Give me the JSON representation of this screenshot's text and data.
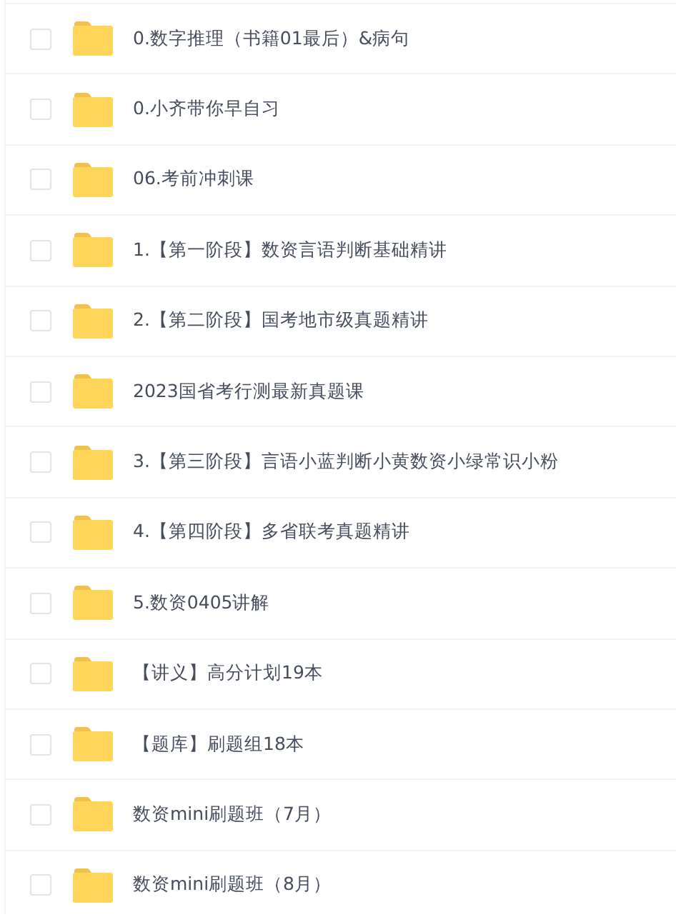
{
  "files": [
    {
      "name": "0.数字推理（书籍01最后）&病句",
      "checked": false
    },
    {
      "name": "0.小齐带你早自习",
      "checked": false
    },
    {
      "name": "06.考前冲刺课",
      "checked": false
    },
    {
      "name": "1.【第一阶段】数资言语判断基础精讲",
      "checked": false
    },
    {
      "name": "2.【第二阶段】国考地市级真题精讲",
      "checked": false
    },
    {
      "name": "2023国省考行测最新真题课",
      "checked": false
    },
    {
      "name": "3.【第三阶段】言语小蓝判断小黄数资小绿常识小粉",
      "checked": false
    },
    {
      "name": "4.【第四阶段】多省联考真题精讲",
      "checked": false
    },
    {
      "name": "5.数资0405讲解",
      "checked": false
    },
    {
      "name": "【讲义】高分计划19本",
      "checked": false
    },
    {
      "name": "【题库】刷题组18本",
      "checked": false
    },
    {
      "name": "数资mini刷题班（7月）",
      "checked": false
    },
    {
      "name": "数资mini刷题班（8月）",
      "checked": false
    }
  ]
}
